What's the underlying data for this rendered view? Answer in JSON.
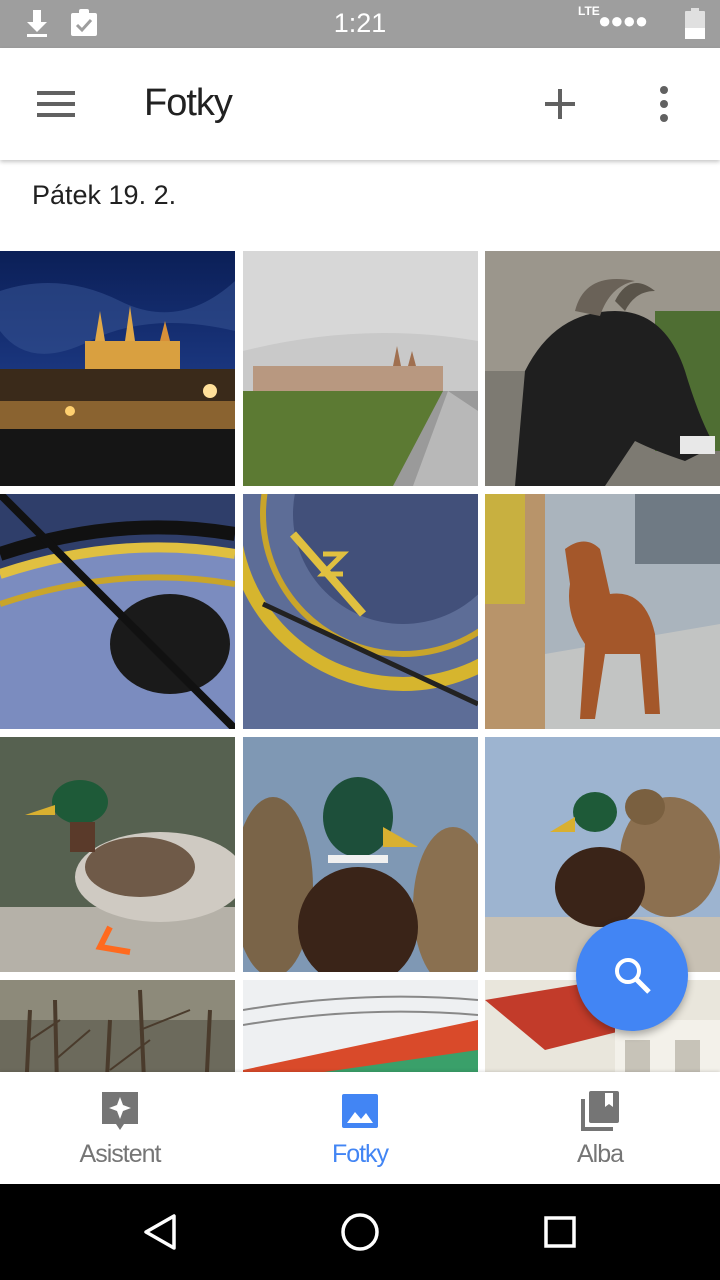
{
  "status_bar": {
    "time": "1:21",
    "network": "LTE",
    "signal_dots": "●●●●",
    "icons": [
      "download-icon",
      "clipboard-check-icon",
      "signal-icon",
      "battery-icon"
    ],
    "background_color": "#9e9e9e"
  },
  "app_bar": {
    "title": "Fotky",
    "menu_icon": "hamburger-menu-icon",
    "add_icon": "plus-icon",
    "more_icon": "more-vert-icon"
  },
  "content": {
    "date_header": "Pátek 19. 2.",
    "photos": [
      {
        "subject": "castle-at-night"
      },
      {
        "subject": "town-cobblestone-path"
      },
      {
        "subject": "black-goat"
      },
      {
        "subject": "astronomical-clock-1"
      },
      {
        "subject": "astronomical-clock-2"
      },
      {
        "subject": "brown-dog"
      },
      {
        "subject": "mallard-duck-walking"
      },
      {
        "subject": "ducks-closeup"
      },
      {
        "subject": "ducks-group"
      },
      {
        "subject": "bare-trees"
      },
      {
        "subject": "wire-fence-sign"
      },
      {
        "subject": "building-roof"
      }
    ]
  },
  "fab": {
    "icon": "search-icon",
    "color": "#4285f4"
  },
  "bottom_nav": {
    "items": [
      {
        "label": "Asistent",
        "icon": "sparkle-assistant-icon",
        "active": false
      },
      {
        "label": "Fotky",
        "icon": "photo-icon",
        "active": true
      },
      {
        "label": "Alba",
        "icon": "albums-icon",
        "active": false
      }
    ],
    "active_color": "#4285f4",
    "inactive_color": "#757575"
  },
  "system_nav": {
    "icons": [
      "back-triangle-icon",
      "home-circle-icon",
      "recents-square-icon"
    ]
  }
}
